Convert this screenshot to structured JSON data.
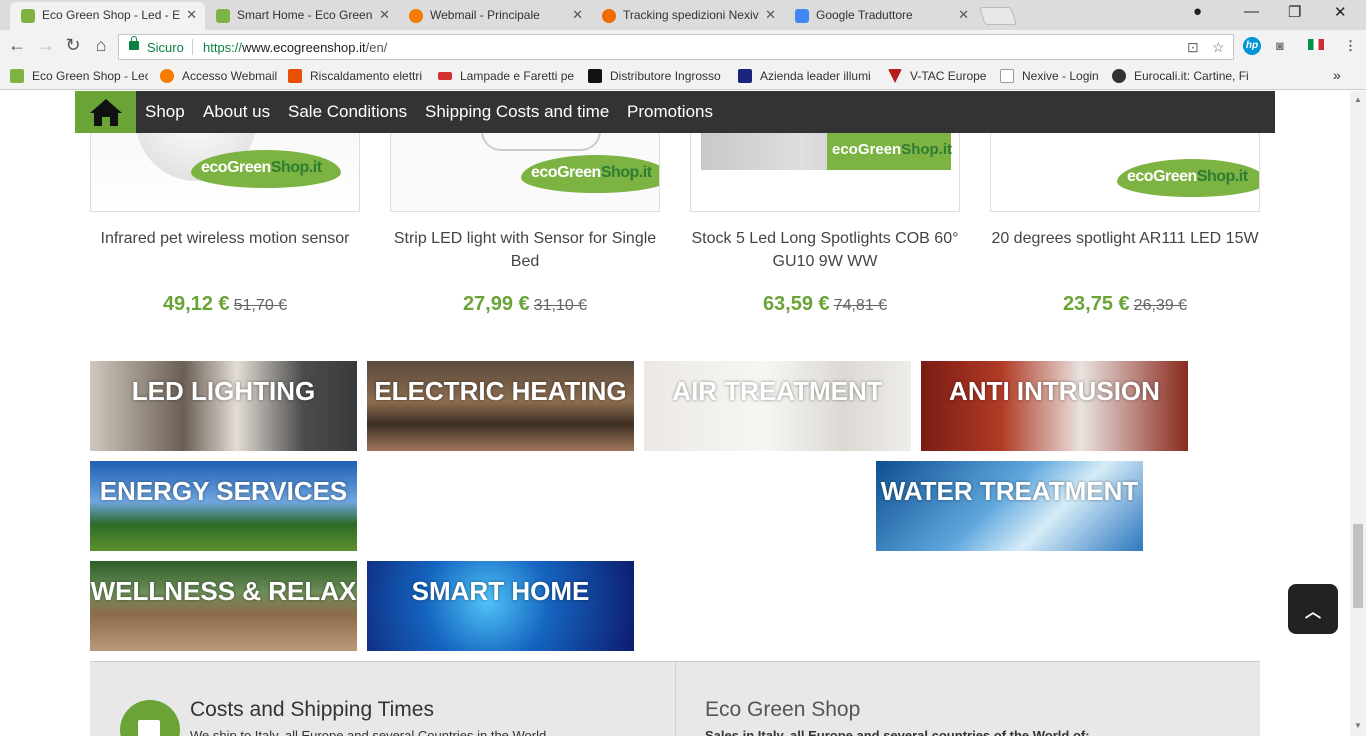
{
  "tabs": [
    {
      "title": "Eco Green Shop - Led - E",
      "active": true
    },
    {
      "title": "Smart Home - Eco Green",
      "active": false
    },
    {
      "title": "Webmail - Principale",
      "active": false
    },
    {
      "title": "Tracking spedizioni Nexiv",
      "active": false
    },
    {
      "title": "Google Traduttore",
      "active": false
    }
  ],
  "address_bar": {
    "security_label": "Sicuro",
    "url_scheme": "https://",
    "url_host": "www.ecogreenshop.it",
    "url_path": "/en/"
  },
  "bookmarks": [
    "Eco Green Shop - Lec",
    "Accesso Webmail",
    "Riscaldamento elettri",
    "Lampade e Faretti pe",
    "Distributore Ingrosso",
    "Azienda leader illumi",
    "V-TAC Europe",
    "Nexive - Login",
    "Eurocali.it: Cartine, Fil"
  ],
  "bookmarks_overflow": "»",
  "site_nav": {
    "items": [
      "Shop",
      "About us",
      "Sale Conditions",
      "Shipping Costs and time",
      "Promotions"
    ]
  },
  "logo_text": {
    "eco": "ecoGreen",
    "shop": "Shop.it"
  },
  "products": [
    {
      "name": "Infrared pet wireless motion sensor",
      "price": "49,12 €",
      "old_price": "51,70 €"
    },
    {
      "name": "Strip LED light with Sensor for Single Bed",
      "price": "27,99 €",
      "old_price": "31,10 €"
    },
    {
      "name": "Stock 5 Led Long Spotlights COB 60° GU10 9W WW",
      "price": "63,59 €",
      "old_price": "74,81 €"
    },
    {
      "name": "20 degrees spotlight AR111 LED 15W",
      "price": "23,75 €",
      "old_price": "26,39 €"
    }
  ],
  "categories": [
    {
      "label": "LED LIGHTING"
    },
    {
      "label": "ELECTRIC HEATING"
    },
    {
      "label": "AIR TREATMENT"
    },
    {
      "label": "ANTI INTRUSION"
    },
    {
      "label": "ENERGY SERVICES"
    },
    {
      "label": "WATER TREATMENT"
    },
    {
      "label": "WELLNESS & RELAX"
    },
    {
      "label": "SMART HOME"
    }
  ],
  "footer": {
    "left_title": "Costs and Shipping Times",
    "left_text": "We ship to Italy, all Europe and several Countries in the World",
    "right_title": "Eco Green Shop",
    "right_text": "Sales in Italy, all Europe and several countries of the World of:"
  },
  "colors": {
    "brand_green": "#6aa336",
    "nav_dark": "#333333",
    "secure_green": "#0b8043"
  }
}
